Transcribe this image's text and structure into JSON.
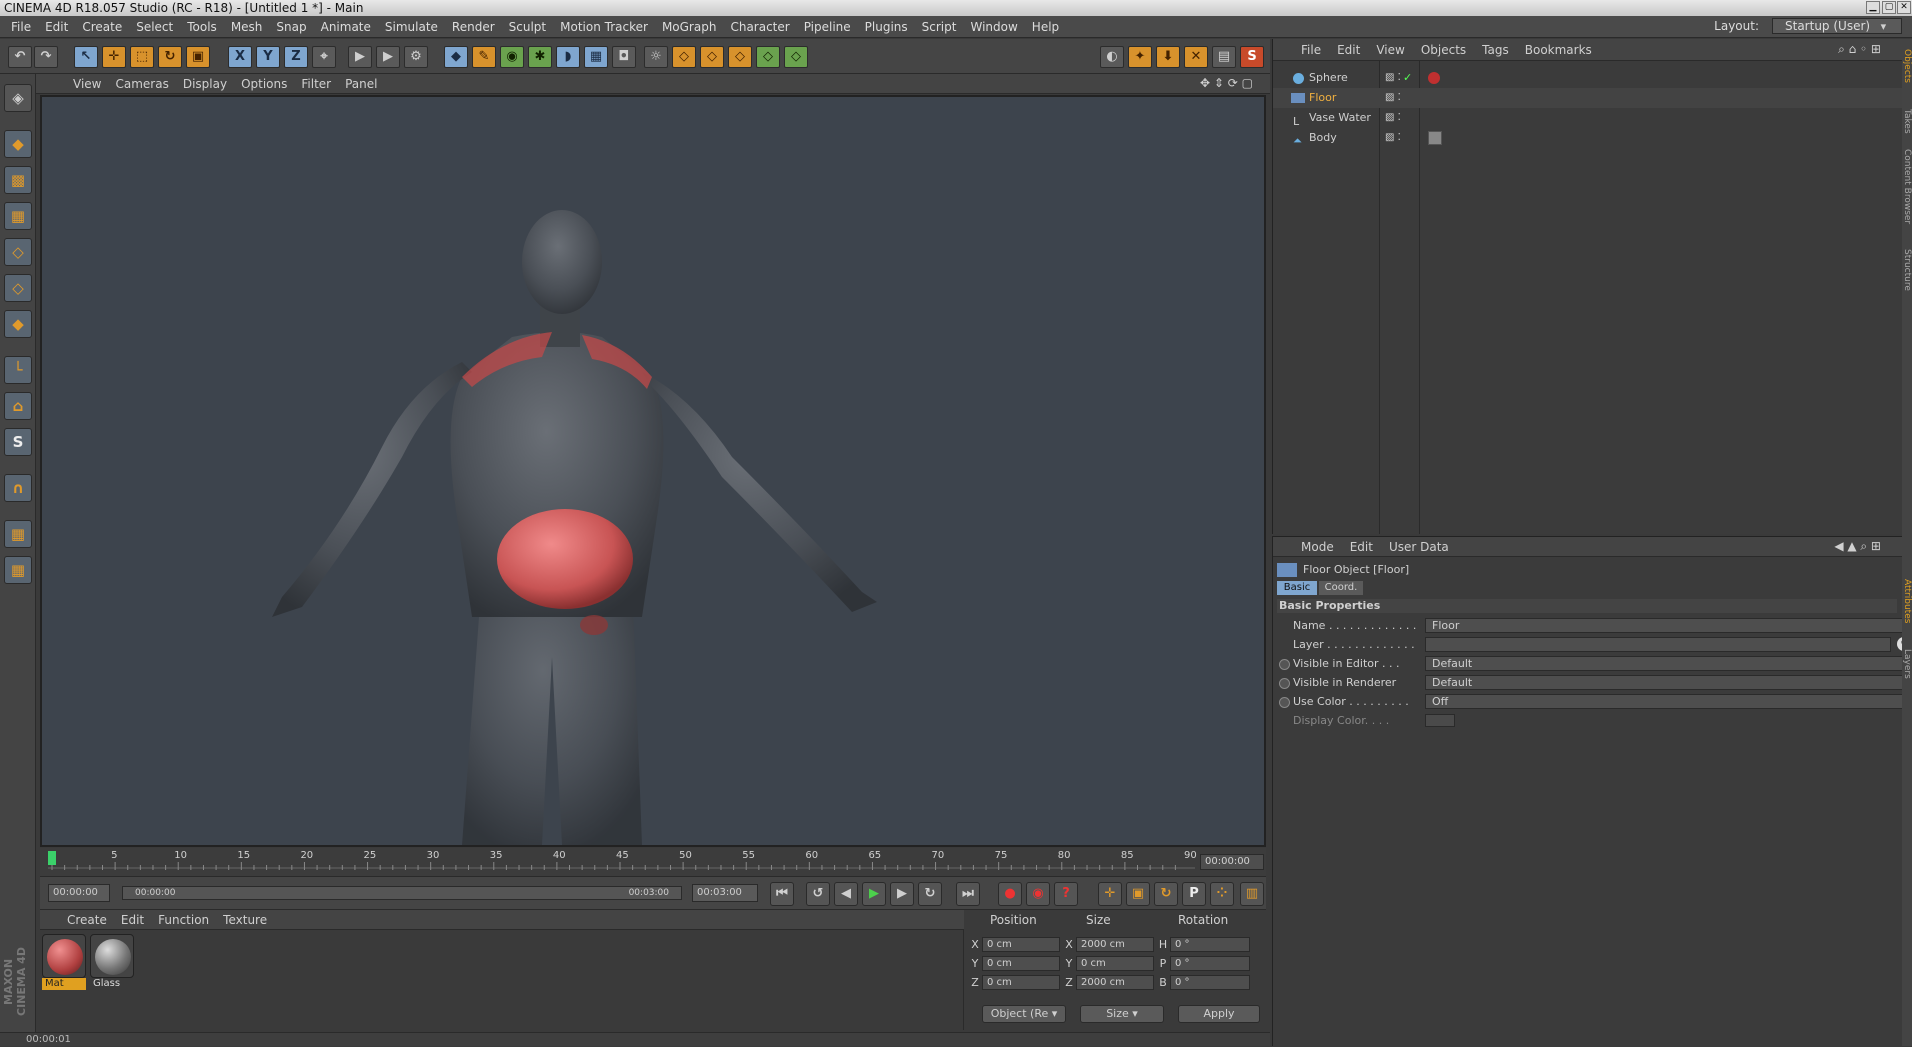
{
  "window": {
    "title": "CINEMA 4D R18.057 Studio (RC - R18) - [Untitled 1 *] - Main"
  },
  "menu": [
    "File",
    "Edit",
    "Create",
    "Select",
    "Tools",
    "Mesh",
    "Snap",
    "Animate",
    "Simulate",
    "Render",
    "Sculpt",
    "Motion Tracker",
    "MoGraph",
    "Character",
    "Pipeline",
    "Plugins",
    "Script",
    "Window",
    "Help"
  ],
  "layout": {
    "label": "Layout:",
    "value": "Startup (User)"
  },
  "toolbar": {
    "x_label": "X",
    "y_label": "Y",
    "z_label": "Z"
  },
  "viewport": {
    "menu": [
      "View",
      "Cameras",
      "Display",
      "Options",
      "Filter",
      "Panel"
    ]
  },
  "timeline": {
    "ticks": [
      "0",
      "5",
      "10",
      "15",
      "20",
      "25",
      "30",
      "35",
      "40",
      "45",
      "50",
      "55",
      "60",
      "65",
      "70",
      "75",
      "80",
      "85",
      "90"
    ],
    "current_time": "00:00:00"
  },
  "transport": {
    "start": "00:00:00",
    "range_start": "00:00:00",
    "range_end": "00:03:00",
    "end": "00:03:00"
  },
  "materials": {
    "menu": [
      "Create",
      "Edit",
      "Function",
      "Texture"
    ],
    "items": [
      {
        "name": "Mat"
      },
      {
        "name": "Glass"
      }
    ]
  },
  "coords": {
    "headers": {
      "position": "Position",
      "size": "Size",
      "rotation": "Rotation"
    },
    "rows": [
      {
        "axis": "X",
        "pos": "0 cm",
        "size_axis": "X",
        "size": "2000 cm",
        "rot_axis": "H",
        "rot": "0 °"
      },
      {
        "axis": "Y",
        "pos": "0 cm",
        "size_axis": "Y",
        "size": "0 cm",
        "rot_axis": "P",
        "rot": "0 °"
      },
      {
        "axis": "Z",
        "pos": "0 cm",
        "size_axis": "Z",
        "size": "2000 cm",
        "rot_axis": "B",
        "rot": "0 °"
      }
    ],
    "mode": "Object (Re",
    "size_mode": "Size",
    "apply": "Apply"
  },
  "objects": {
    "menu": [
      "File",
      "Edit",
      "View",
      "Objects",
      "Tags",
      "Bookmarks"
    ],
    "items": [
      {
        "name": "Sphere"
      },
      {
        "name": "Floor"
      },
      {
        "name": "Vase Water"
      },
      {
        "name": "Body"
      }
    ]
  },
  "attributes": {
    "menu": [
      "Mode",
      "Edit",
      "User Data"
    ],
    "object_title": "Floor Object [Floor]",
    "tabs": [
      "Basic",
      "Coord."
    ],
    "section": "Basic Properties",
    "props": [
      {
        "label": "Name . . . . . . . . . . . . .",
        "value": "Floor"
      },
      {
        "label": "Layer . . . . . . . . . . . . .",
        "value": ""
      },
      {
        "label": "Visible in Editor . . .",
        "value": "Default"
      },
      {
        "label": "Visible in Renderer",
        "value": "Default"
      },
      {
        "label": "Use Color . . . . . . . . .",
        "value": "Off"
      },
      {
        "label": "Display Color. . . .",
        "value": ""
      }
    ]
  },
  "side_tabs": [
    "Objects",
    "Takes",
    "Content Browser",
    "Structure",
    "Attributes",
    "Layers"
  ],
  "branding": {
    "logo": "MAXON CINEMA 4D"
  },
  "status": {
    "text": "00:00:01"
  }
}
